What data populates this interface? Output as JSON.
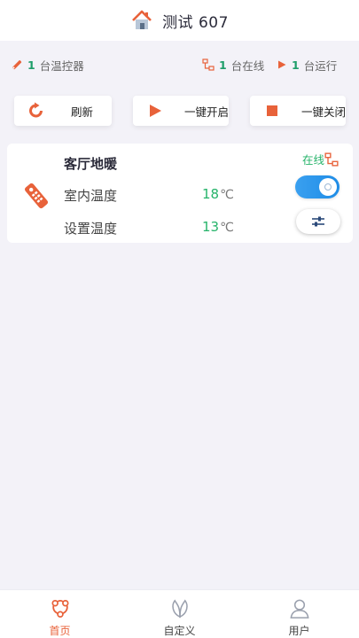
{
  "header": {
    "title": "测试 607",
    "icon": "house-icon"
  },
  "stats": {
    "controllers": {
      "count": "1",
      "label": "台温控器",
      "icon": "wrench-icon"
    },
    "online": {
      "count": "1",
      "label": "台在线",
      "icon": "network-icon"
    },
    "running": {
      "count": "1",
      "label": "台运行",
      "icon": "play-icon"
    }
  },
  "actions": {
    "refresh": "刷新",
    "start_all": "一键开启",
    "stop_all": "一键关闭"
  },
  "device": {
    "name": "客厅地暖",
    "status": "在线",
    "indoor_label": "室内温度",
    "indoor_value": "18",
    "set_label": "设置温度",
    "set_value": "13",
    "unit": "℃",
    "power_on": true
  },
  "tabs": [
    {
      "label": "首页",
      "icon": "home-nodes-icon",
      "active": true
    },
    {
      "label": "自定义",
      "icon": "leaf-icon",
      "active": false
    },
    {
      "label": "用户",
      "icon": "user-icon",
      "active": false
    }
  ],
  "colors": {
    "accent": "#e8623a",
    "green": "#26b36a",
    "blue": "#1e8ce6"
  }
}
